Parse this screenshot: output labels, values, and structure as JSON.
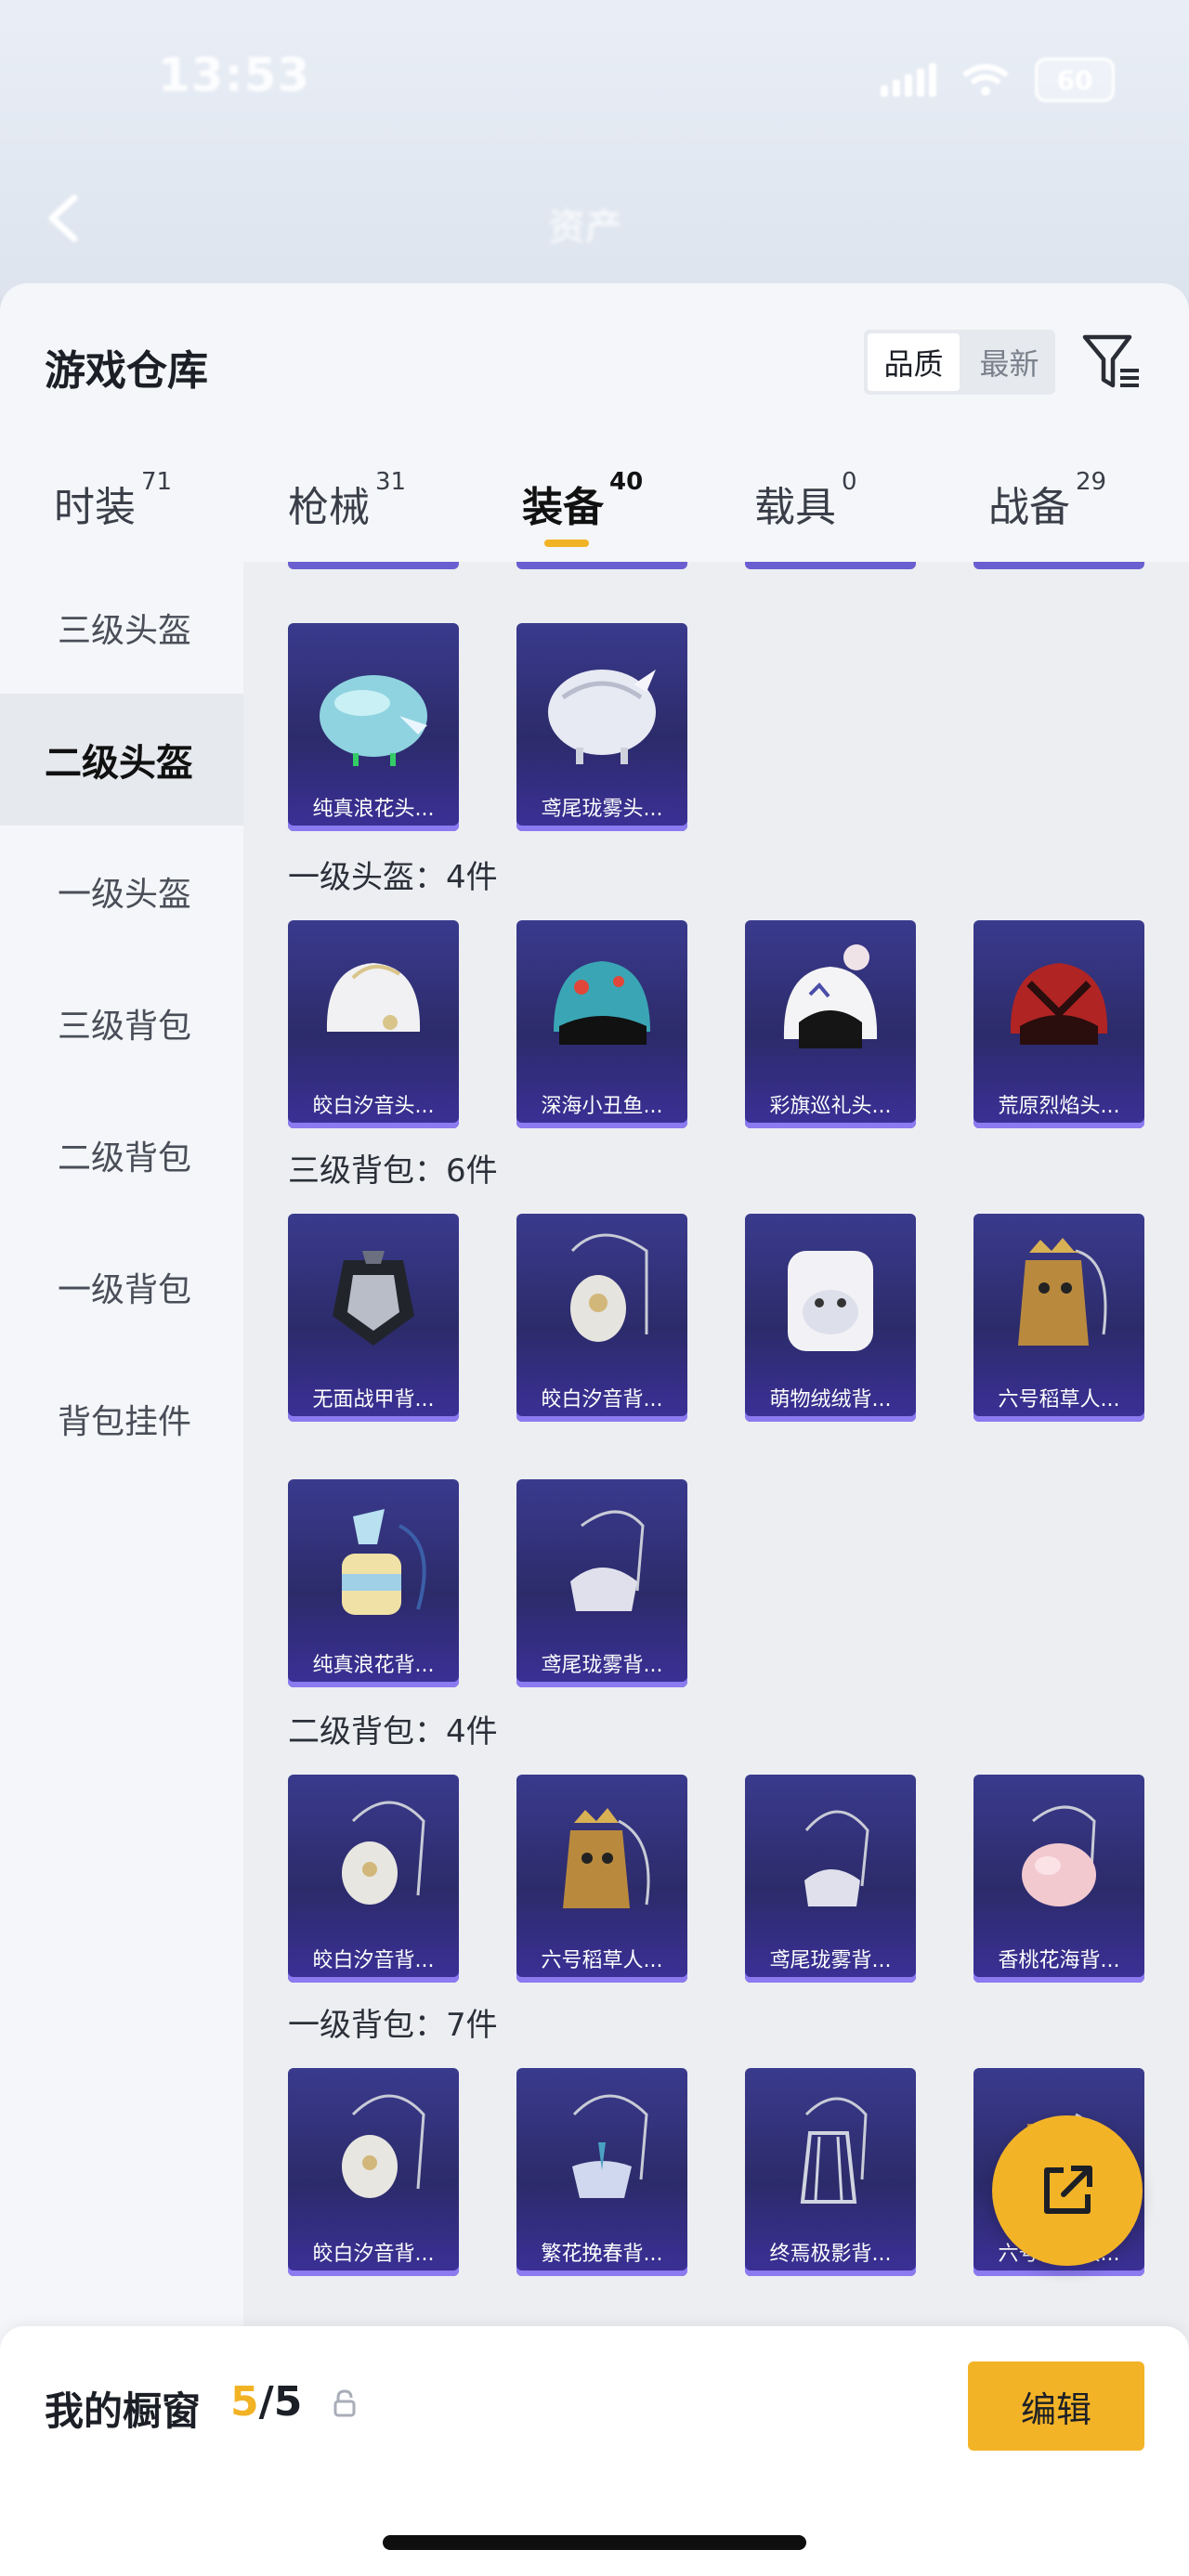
{
  "status_bar": {
    "time": "13:53",
    "battery": "60"
  },
  "header": {
    "title": "资产"
  },
  "sheet": {
    "title": "游戏仓库",
    "sort_options": [
      "品质",
      "最新"
    ],
    "sort_active": "品质"
  },
  "tabs": [
    {
      "label": "时装",
      "count": "71"
    },
    {
      "label": "枪械",
      "count": "31"
    },
    {
      "label": "装备",
      "count": "40",
      "active": true
    },
    {
      "label": "载具",
      "count": "0"
    },
    {
      "label": "战备",
      "count": "29"
    }
  ],
  "sidebar": {
    "items": [
      {
        "label": "三级头盔"
      },
      {
        "label": "二级头盔",
        "active": true
      },
      {
        "label": "一级头盔"
      },
      {
        "label": "三级背包"
      },
      {
        "label": "二级背包"
      },
      {
        "label": "一级背包"
      },
      {
        "label": "背包挂件"
      }
    ]
  },
  "sections": {
    "helmet2": {
      "items": [
        "纯真浪花头...",
        "鸢尾珑雾头..."
      ]
    },
    "helmet1": {
      "label": "一级头盔：4件",
      "items": [
        "皎白汐音头...",
        "深海小丑鱼...",
        "彩旗巡礼头...",
        "荒原烈焰头..."
      ]
    },
    "bag3": {
      "label": "三级背包：6件",
      "items": [
        "无面战甲背...",
        "皎白汐音背...",
        "萌物绒绒背...",
        "六号稻草人...",
        "纯真浪花背...",
        "鸢尾珑雾背..."
      ]
    },
    "bag2": {
      "label": "二级背包：4件",
      "items": [
        "皎白汐音背...",
        "六号稻草人...",
        "鸢尾珑雾背...",
        "香桃花海背..."
      ]
    },
    "bag1": {
      "label": "一级背包：7件",
      "items": [
        "皎白汐音背...",
        "繁花挽春背...",
        "终焉极影背...",
        "六号稻草人..."
      ]
    }
  },
  "showcase": {
    "title": "我的橱窗",
    "count_used": "5",
    "count_sep": "/",
    "count_total": "5",
    "edit_label": "编辑"
  },
  "colors": {
    "accent": "#f3b327",
    "card_top": "#3a3a8e",
    "card_glow": "#8b7af0"
  }
}
